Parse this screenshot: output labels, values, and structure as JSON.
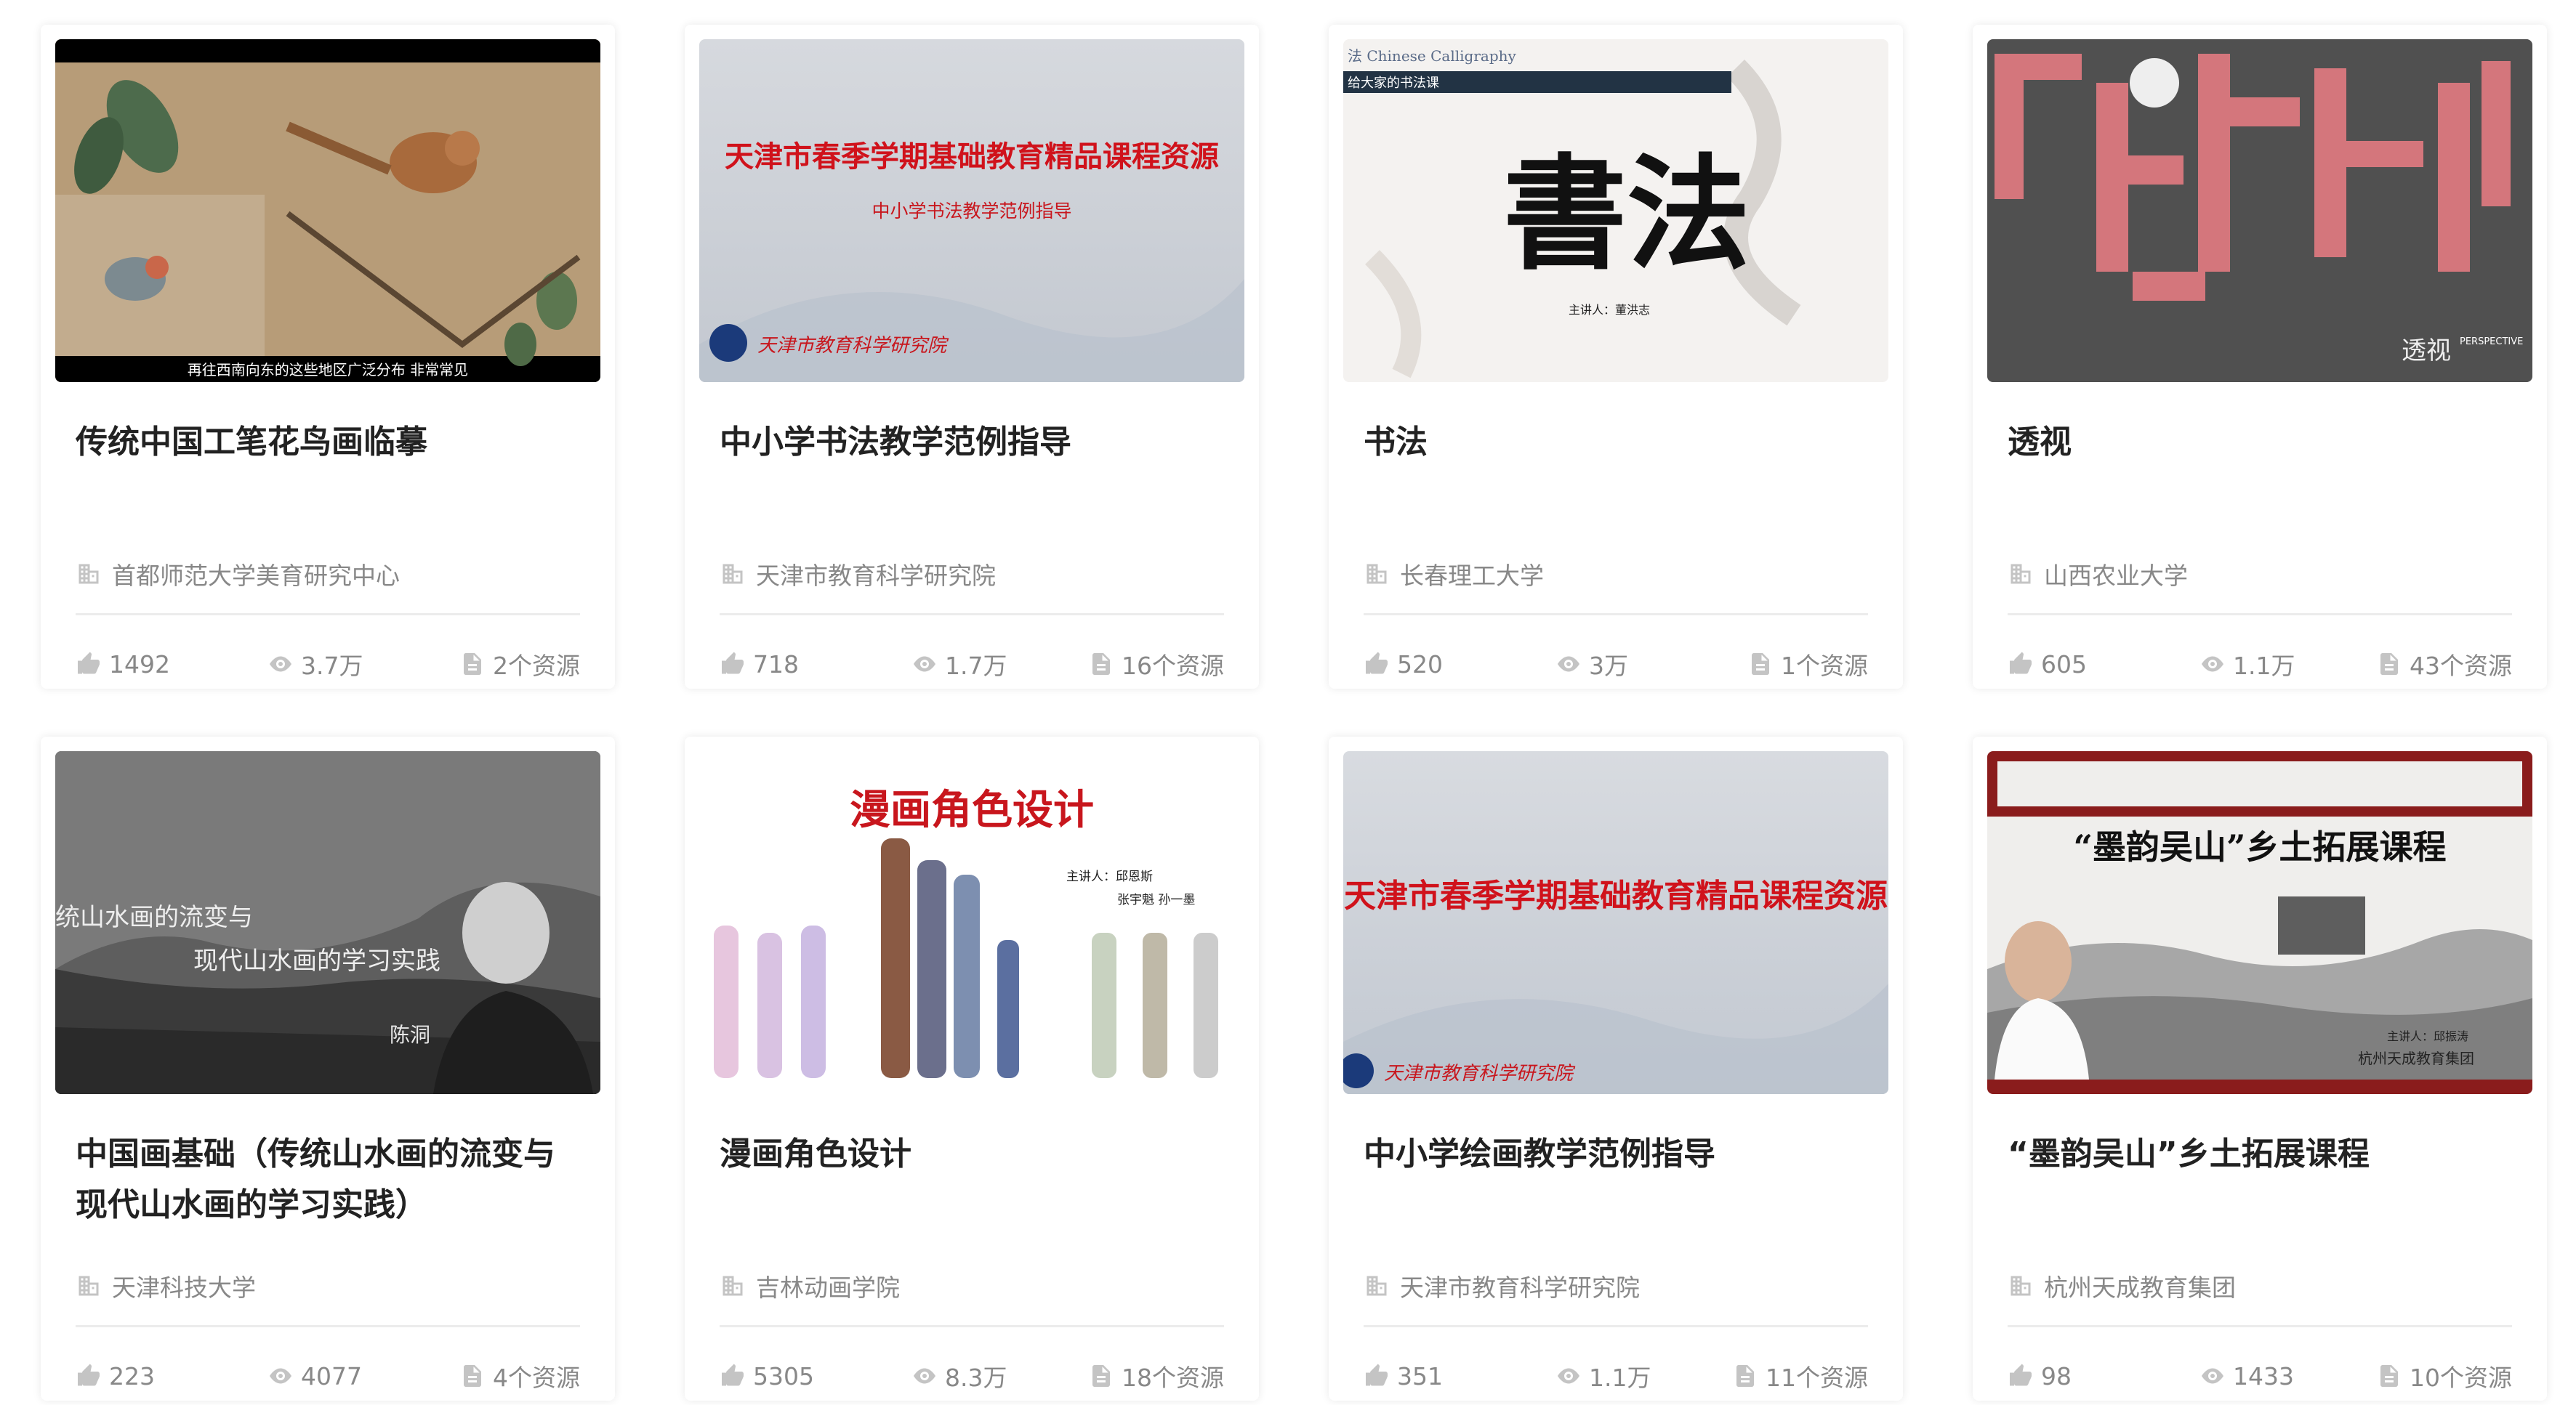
{
  "cards": [
    {
      "title": "传统中国工笔花鸟画临摹",
      "org": "首都师范大学美育研究中心",
      "likes": "1492",
      "views": "3.7万",
      "resources": "2个资源",
      "thumb": {
        "caption": "再往西南向东的这些地区广泛分布  非常常见"
      }
    },
    {
      "title": "中小学书法教学范例指导",
      "org": "天津市教育科学研究院",
      "likes": "718",
      "views": "1.7万",
      "resources": "16个资源",
      "thumb": {
        "heading": "天津市春季学期基础教育精品课程资源",
        "sub": "中小学书法教学范例指导",
        "footer": "天津市教育科学研究院"
      }
    },
    {
      "title": "书法",
      "org": "长春理工大学",
      "likes": "520",
      "views": "3万",
      "resources": "1个资源",
      "thumb": {
        "top": "法  Chinese Calligraphy",
        "bar": "给大家的书法课",
        "big": "書法",
        "speaker": "主讲人：董洪志"
      }
    },
    {
      "title": "透视",
      "org": "山西农业大学",
      "likes": "605",
      "views": "1.1万",
      "resources": "43个资源",
      "thumb": {
        "label": "透视",
        "en": "PERSPECTIVE"
      }
    },
    {
      "title": "中国画基础（传统山水画的流变与现代山水画的学习实践）",
      "org": "天津科技大学",
      "likes": "223",
      "views": "4077",
      "resources": "4个资源",
      "thumb": {
        "line1": "统山水画的流变与",
        "line2": "现代山水画的学习实践",
        "sign": "陈洞"
      }
    },
    {
      "title": "漫画角色设计",
      "org": "吉林动画学院",
      "likes": "5305",
      "views": "8.3万",
      "resources": "18个资源",
      "thumb": {
        "heading": "漫画角色设计",
        "speaker1": "主讲人：邱恩斯",
        "speaker2": "张宇魁  孙一墨"
      }
    },
    {
      "title": "中小学绘画教学范例指导",
      "org": "天津市教育科学研究院",
      "likes": "351",
      "views": "1.1万",
      "resources": "11个资源",
      "thumb": {
        "heading": "天津市春季学期基础教育精品课程资源",
        "footer": "天津市教育科学研究院"
      }
    },
    {
      "title": "“墨韵吴山”乡土拓展课程",
      "org": "杭州天成教育集团",
      "likes": "98",
      "views": "1433",
      "resources": "10个资源",
      "thumb": {
        "heading": "“墨韵吴山”乡土拓展课程",
        "speaker": "主讲人：邱振涛",
        "footer": "杭州天成教育集团"
      }
    }
  ],
  "colors": {
    "accent_red": "#c8161d",
    "text_dark": "#222222",
    "text_muted": "#888888"
  }
}
